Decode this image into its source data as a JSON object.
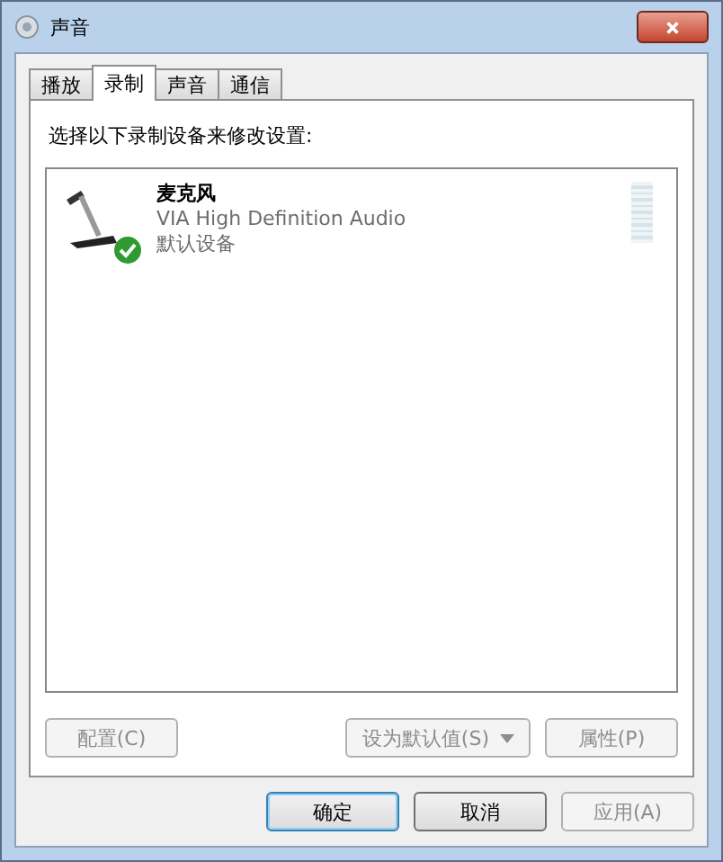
{
  "window": {
    "title": "声音"
  },
  "tabs": [
    {
      "label": "播放",
      "selected": false
    },
    {
      "label": "录制",
      "selected": true
    },
    {
      "label": "声音",
      "selected": false
    },
    {
      "label": "通信",
      "selected": false
    }
  ],
  "instruction": "选择以下录制设备来修改设置:",
  "devices": [
    {
      "name": "麦克风",
      "driver": "VIA High Definition Audio",
      "status": "默认设备",
      "default": true,
      "selected": false,
      "level": 0
    }
  ],
  "device_buttons": [
    {
      "label": "配置(C)",
      "disabled": true,
      "dropdown": false
    },
    {
      "label": "设为默认值(S)",
      "disabled": true,
      "dropdown": true
    },
    {
      "label": "属性(P)",
      "disabled": true,
      "dropdown": false
    }
  ],
  "dialog_buttons": [
    {
      "label": "确定",
      "disabled": false,
      "default": true
    },
    {
      "label": "取消",
      "disabled": false,
      "default": false
    },
    {
      "label": "应用(A)",
      "disabled": true,
      "default": false
    }
  ]
}
